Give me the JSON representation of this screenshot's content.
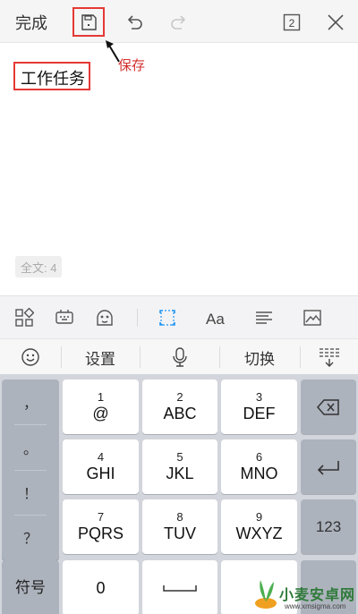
{
  "toolbar": {
    "done_label": "完成",
    "pages_count": "2",
    "icons": [
      "save-icon",
      "undo-icon",
      "redo-icon",
      "page-count-icon",
      "close-icon"
    ]
  },
  "annotation": {
    "save_label": "保存"
  },
  "document": {
    "title": "工作任务",
    "word_count": "全文: 4"
  },
  "ime_tools": {
    "icons": [
      "apps-grid-icon",
      "keyboard-robot-icon",
      "emoji-face-icon",
      "crop-select-icon",
      "font-size-icon",
      "align-icon",
      "image-icon"
    ]
  },
  "ime_bar": {
    "settings_label": "设置",
    "switch_label": "切换",
    "icons": [
      "smiley-icon",
      "microphone-icon",
      "collapse-keyboard-icon"
    ]
  },
  "keyboard": {
    "symbols": [
      "，",
      "。",
      "！",
      "？"
    ],
    "keys": [
      {
        "num": "1",
        "let": "@"
      },
      {
        "num": "2",
        "let": "ABC"
      },
      {
        "num": "3",
        "let": "DEF"
      },
      {
        "num": "4",
        "let": "GHI"
      },
      {
        "num": "5",
        "let": "JKL"
      },
      {
        "num": "6",
        "let": "MNO"
      },
      {
        "num": "7",
        "let": "PQRS"
      },
      {
        "num": "8",
        "let": "TUV"
      },
      {
        "num": "9",
        "let": "WXYZ"
      }
    ],
    "fuhao_label": "符号",
    "zero_label": "0",
    "num123_label": "123"
  },
  "watermark": {
    "text": "小麦安卓网",
    "sub": "www.xmsigma.com"
  },
  "colors": {
    "highlight_red": "#e53935",
    "annotation_red": "#d32f2f",
    "keyboard_bg": "#d2d5db",
    "accent_blue": "#2196f3"
  }
}
